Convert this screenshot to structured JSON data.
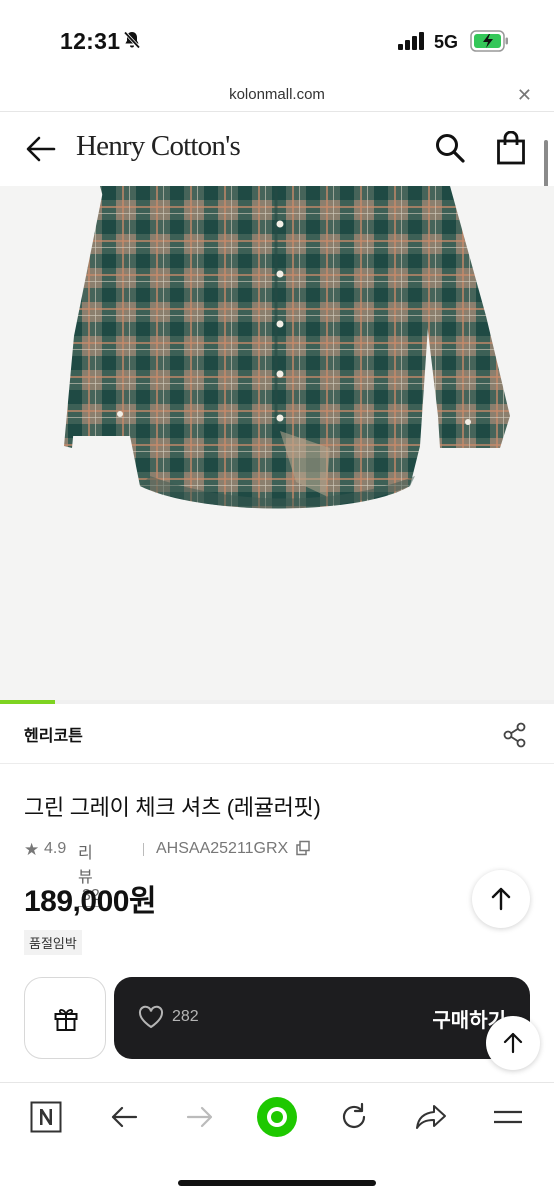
{
  "status_bar": {
    "time": "12:31",
    "network": "5G"
  },
  "browser": {
    "url": "kolonmall.com"
  },
  "header": {
    "brand_logo": "Henry Cotton's"
  },
  "gallery": {
    "progress": 0.1
  },
  "brand_row": {
    "brand": "헨리코튼"
  },
  "product": {
    "title": "그린 그레이 체크 셔츠 (레귤러핏)",
    "rating": "4.9",
    "review_label": "리뷰",
    "review_count": "32",
    "product_code": "AHSAA25211GRX",
    "price": "189,000원",
    "badge": "품절임박"
  },
  "actions": {
    "like_count": "282",
    "buy_label": "구매하기"
  },
  "colors": {
    "accent_green": "#7ed321",
    "dark_button": "#1d1d1f",
    "naver_green": "#1ec800"
  },
  "icons": [
    "back-arrow-icon",
    "search-icon",
    "shopping-bag-icon",
    "share-icon",
    "star-icon",
    "copy-icon",
    "gift-icon",
    "heart-icon",
    "arrow-up-icon",
    "naver-icon",
    "forward-icon",
    "reload-icon",
    "share-arrow-icon",
    "menu-icon"
  ]
}
